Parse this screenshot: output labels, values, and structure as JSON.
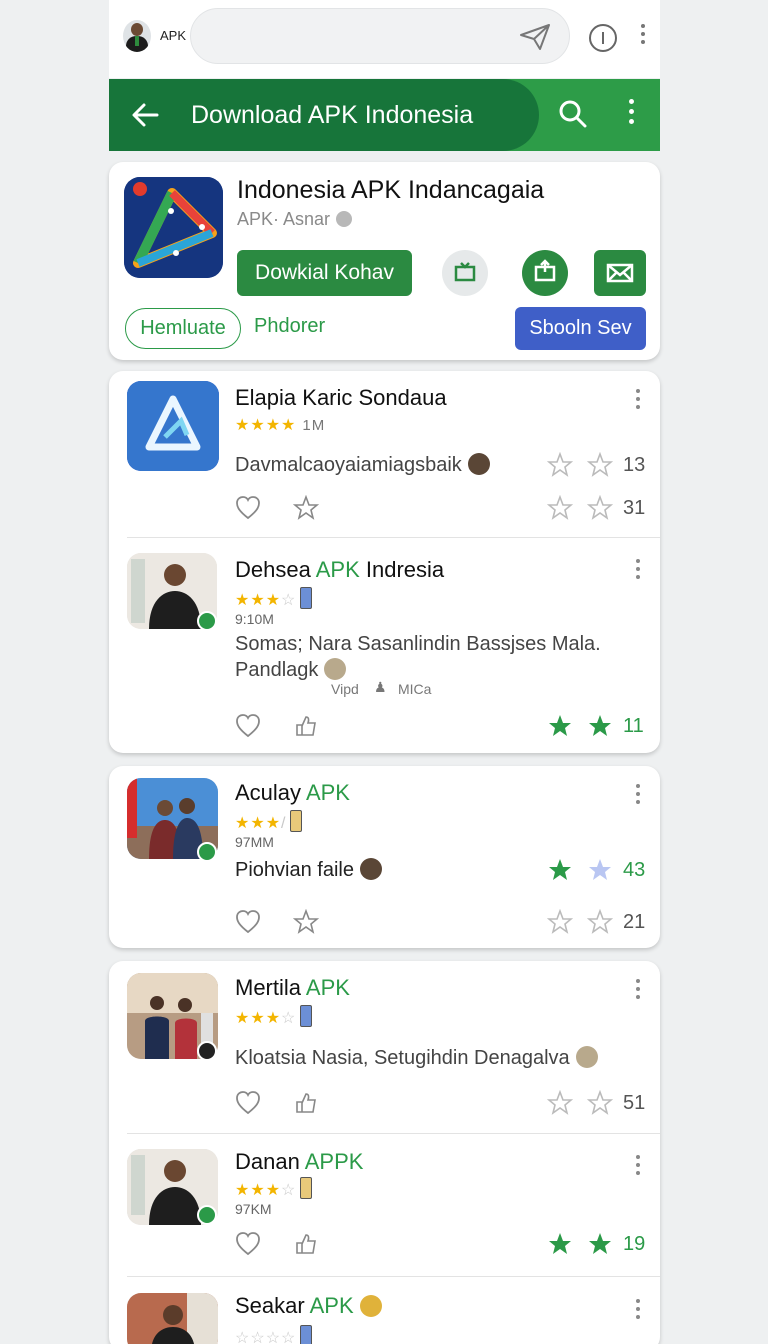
{
  "topbar": {
    "label": "APK",
    "icons": [
      "avatar",
      "send-icon",
      "info-icon",
      "more-vert-icon"
    ]
  },
  "header": {
    "title": "Download APK Indonesia",
    "color": "#2d9c48"
  },
  "featured": {
    "name": "Indonesia APK Indancagaia",
    "subtitle": "APK· Asnar",
    "download_label": "Dowkial Kohav",
    "chip_label": "Hemluate",
    "chip_link": "Phdorer",
    "blue_button": "Sbooln Sev"
  },
  "items": [
    {
      "name": "Elapia Karic Sondaua",
      "stars": "★★★★",
      "empty": "",
      "size_inline": "1M",
      "desc": "Davmalcaoyaiamiagsbaik",
      "count1": "13",
      "count2": "31"
    },
    {
      "name": "Dehsea ",
      "apk": "APK",
      "name_tail": " Indresia",
      "stars": "★★★",
      "empty": "☆",
      "size": "9:10M",
      "desc1": "Somas; Nara Sasanlindin Bassjses Mala.",
      "desc2": "Pandlagk",
      "small": "Vipd",
      "small2": "MICa",
      "count1": "11"
    },
    {
      "name": "Aculay ",
      "apk": "APK",
      "stars": "★★★",
      "empty": "/",
      "size": "97MM",
      "desc": "Piohvian faile",
      "count1": "43",
      "count2": "21"
    },
    {
      "name": "Mertila ",
      "apk": "APK",
      "stars": "★★★",
      "empty": "☆",
      "desc": "Kloatsia Nasia, Setugihdin Denagalva",
      "count1": "51"
    },
    {
      "name": "Danan ",
      "apk": "APPK",
      "stars": "★★★",
      "empty": "☆",
      "size": "97KM",
      "count1": "19"
    },
    {
      "name": "Seakar ",
      "apk": "APK",
      "stars": "",
      "empty": "☆☆☆☆"
    }
  ]
}
